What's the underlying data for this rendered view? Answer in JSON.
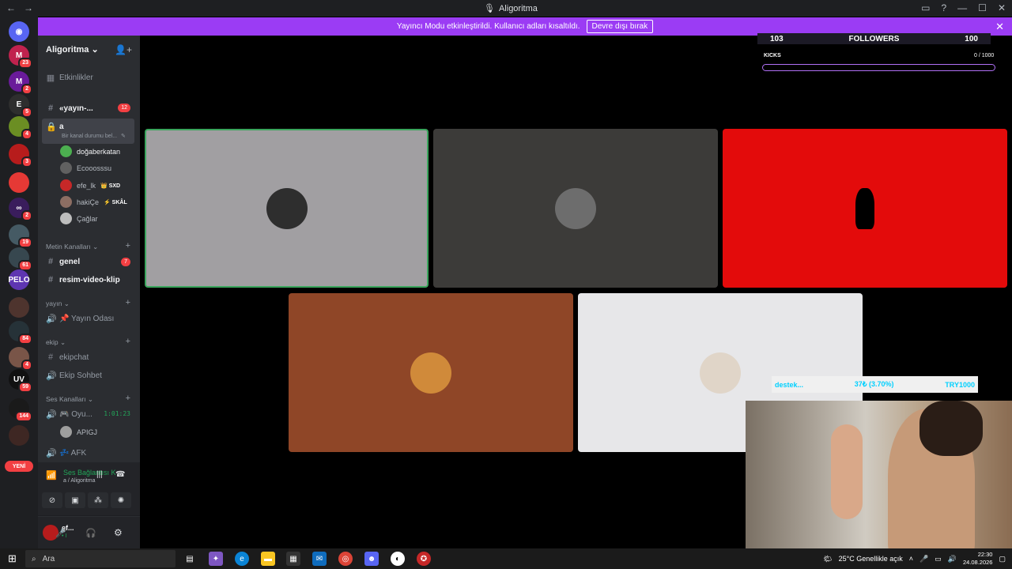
{
  "window": {
    "title": "Aligoritma"
  },
  "banner": {
    "message": "Yayıncı Modu etkinleştirildi. Kullanıcı adları kısaltıldı.",
    "button": "Devre dışı bırak"
  },
  "servers": [
    {
      "label": "M",
      "badge": "23",
      "color": "#c0224e"
    },
    {
      "label": "M",
      "badge": "2",
      "color": "#6a1b9a"
    },
    {
      "label": "E",
      "badge": "5",
      "color": "#2e2e2e"
    },
    {
      "label": "",
      "badge": "4",
      "color": "#6b8e23"
    },
    {
      "label": "",
      "badge": "3",
      "color": "#b71c1c"
    },
    {
      "label": "",
      "badge": "",
      "color": "#e53935"
    },
    {
      "label": "∞",
      "badge": "2",
      "color": "#3a1d5c"
    },
    {
      "label": "",
      "badge": "19",
      "color": "#455a64"
    },
    {
      "label": "",
      "badge": "61",
      "color": "#37474f"
    },
    {
      "label": "PELO",
      "badge": "",
      "color": "#5e35b1"
    },
    {
      "label": "",
      "badge": "",
      "color": "#4e342e"
    },
    {
      "label": "",
      "badge": "84",
      "color": "#263238"
    },
    {
      "label": "",
      "badge": "4",
      "color": "#795548"
    },
    {
      "label": "UV",
      "badge": "59",
      "color": "#111111"
    },
    {
      "label": "",
      "badge": "144",
      "color": "#1a1a1a"
    },
    {
      "label": "",
      "badge": "",
      "color": "#3e2723"
    }
  ],
  "new_tag": "YENİ",
  "sidebar": {
    "guild_name": "Aligoritma",
    "events": "Etkinlikler",
    "channel_yayin": "«yayın-...",
    "channel_yayin_badge": "12",
    "channel_a": "a",
    "channel_a_status": "Bir kanal durumu bel...",
    "voice_users": [
      {
        "name": "doğaberkatan",
        "tag": "",
        "color": "#4caf50"
      },
      {
        "name": "Ecooosssu",
        "tag": "",
        "color": "#616161"
      },
      {
        "name": "efe_lk",
        "tag": "👑 SXD",
        "color": "#c62828"
      },
      {
        "name": "hakiÇe",
        "tag": "⚡ SKÂL",
        "color": "#8d6e63"
      },
      {
        "name": "Çağlar",
        "tag": "",
        "color": "#bdbdbd"
      }
    ],
    "cat_text": "Metin Kanalları",
    "ch_genel": "genel",
    "ch_genel_badge": "7",
    "ch_resim": "resim-video-klip",
    "cat_yayin": "yayın",
    "ch_yayin_odasi": "📌 Yayın Odası",
    "cat_ekip": "ekip",
    "ch_ekipchat": "ekipchat",
    "ch_ekip_sohbet": "Ekip Sohbet",
    "cat_ses": "Ses Kanalları",
    "ch_oyun": "🎮 Oyu...",
    "ch_oyun_time": "1:01:23",
    "oyun_user": "APIGJ",
    "ch_afk": "💤 AFK"
  },
  "voice_panel": {
    "status": "Ses Bağlantısı K",
    "sub": "a / Aligoritma"
  },
  "user_panel": {
    "name": "ef...",
    "status": "• I"
  },
  "overlay": {
    "followers_left": "103",
    "followers_label": "FOLLOWERS",
    "followers_right": "100",
    "kicks_label": "KICKS",
    "kicks_value": "0 / 1000",
    "kicks_fraction": 0,
    "donate_label": "destek...",
    "donate_mid": "37₺ (3.70%)",
    "donate_goal": "TRY1000"
  },
  "tiles": [
    {
      "bg": "#a19fa2",
      "border": "#3ba55d"
    },
    {
      "bg": "#3c3b39",
      "border": ""
    },
    {
      "bg": "#e30b0b",
      "border": ""
    },
    {
      "bg": "#8f4627",
      "border": ""
    },
    {
      "bg": "#e7e7e9",
      "border": ""
    }
  ],
  "taskbar": {
    "search": "Ara",
    "weather": "25°C  Genellikle açık",
    "time": "22:30",
    "date": "24.08.2026"
  }
}
